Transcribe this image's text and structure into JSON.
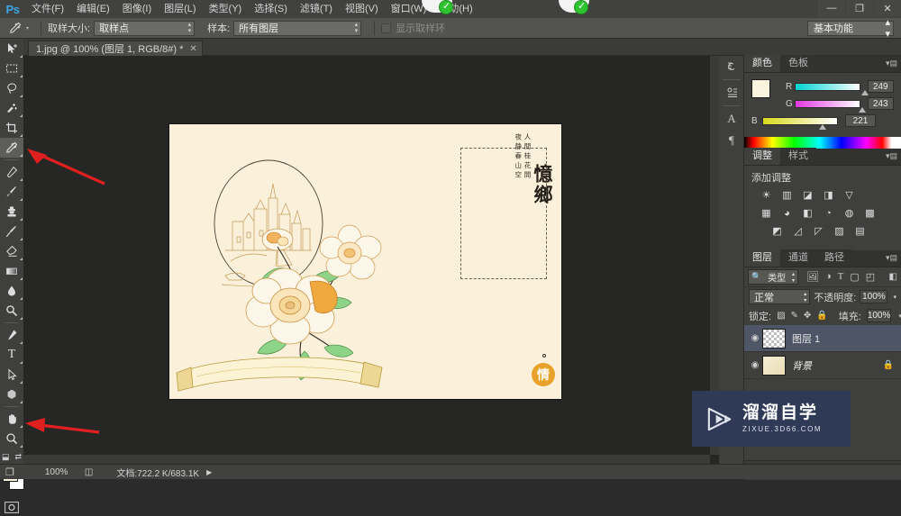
{
  "app": {
    "logo": "Ps",
    "title": "Adobe Photoshop"
  },
  "menubar": {
    "items": [
      {
        "label": "文件(F)"
      },
      {
        "label": "编辑(E)"
      },
      {
        "label": "图像(I)"
      },
      {
        "label": "图层(L)"
      },
      {
        "label": "类型(Y)"
      },
      {
        "label": "选择(S)"
      },
      {
        "label": "滤镜(T)"
      },
      {
        "label": "视图(V)"
      },
      {
        "label": "窗口(W)"
      },
      {
        "label": "帮助(H)"
      }
    ],
    "window_controls": {
      "minimize": "—",
      "restore": "❐",
      "close": "✕"
    }
  },
  "options_bar": {
    "tool_icon": "eyedropper-icon",
    "sample_size_label": "取样大小:",
    "sample_size_value": "取样点",
    "sample_label": "样本:",
    "sample_value": "所有图层",
    "show_ring_label": "显示取样环",
    "workspace_value": "基本功能"
  },
  "document_tab": {
    "title": "1.jpg @ 100% (图层 1, RGB/8#) *",
    "close": "✕"
  },
  "toolbar": {
    "tools": [
      {
        "name": "move-tool",
        "selected": false
      },
      {
        "name": "marquee-tool",
        "selected": false
      },
      {
        "name": "lasso-tool",
        "selected": false
      },
      {
        "name": "quick-selection-tool",
        "selected": false
      },
      {
        "name": "crop-tool",
        "selected": false
      },
      {
        "name": "eyedropper-tool",
        "selected": true
      },
      {
        "name": "healing-brush-tool",
        "selected": false
      },
      {
        "name": "brush-tool",
        "selected": false
      },
      {
        "name": "clone-stamp-tool",
        "selected": false
      },
      {
        "name": "history-brush-tool",
        "selected": false
      },
      {
        "name": "eraser-tool",
        "selected": false
      },
      {
        "name": "gradient-tool",
        "selected": false
      },
      {
        "name": "blur-tool",
        "selected": false
      },
      {
        "name": "dodge-tool",
        "selected": false
      },
      {
        "name": "pen-tool",
        "selected": false
      },
      {
        "name": "type-tool",
        "selected": false
      },
      {
        "name": "path-selection-tool",
        "selected": false
      },
      {
        "name": "shape-tool",
        "selected": false
      },
      {
        "name": "hand-tool",
        "selected": false
      },
      {
        "name": "zoom-tool",
        "selected": false
      }
    ],
    "foreground_color": "#faf3dd",
    "background_color": "#ffffff"
  },
  "canvas": {
    "artboard_color": "#fbf0d9",
    "poem_col_1": "人閒桂花開",
    "poem_col_2": "夜静春山空",
    "title": "憶鄉",
    "seal": "情"
  },
  "icon_dock": {
    "items": [
      {
        "name": "history-icon"
      },
      {
        "name": "actions-icon"
      },
      {
        "name": "character-icon",
        "glyph": "A"
      },
      {
        "name": "paragraph-icon",
        "glyph": "¶"
      }
    ]
  },
  "color_panel": {
    "tabs": [
      {
        "label": "颜色",
        "active": true
      },
      {
        "label": "色板",
        "active": false
      }
    ],
    "channels": [
      {
        "label": "R",
        "value": "249",
        "pos": 84
      },
      {
        "label": "G",
        "value": "243",
        "pos": 81
      },
      {
        "label": "B",
        "value": "221",
        "pos": 73
      }
    ]
  },
  "adjustments_panel": {
    "tabs": [
      {
        "label": "调整",
        "active": true
      },
      {
        "label": "样式",
        "active": false
      }
    ],
    "add_label": "添加调整",
    "rows": [
      [
        "☀",
        "▥",
        "◪",
        "◨",
        "▽"
      ],
      [
        "▦",
        "◕",
        "◧",
        "◔",
        "◍",
        "▩"
      ],
      [
        "◩",
        "◿",
        "◸",
        "▨",
        "▤"
      ]
    ]
  },
  "layers_panel": {
    "tabs": [
      {
        "label": "图层",
        "active": true
      },
      {
        "label": "通道",
        "active": false
      },
      {
        "label": "路径",
        "active": false
      }
    ],
    "kind_filter": "类型",
    "blend_mode": "正常",
    "opacity_label": "不透明度:",
    "opacity_value": "100%",
    "lock_label": "锁定:",
    "fill_label": "填充:",
    "fill_value": "100%",
    "layers": [
      {
        "name": "图层 1",
        "selected": true,
        "locked": false,
        "thumb": "checker",
        "visible": "◉"
      },
      {
        "name": "背景",
        "selected": false,
        "locked": true,
        "thumb": "bg",
        "visible": "◉"
      }
    ],
    "footer_icons": [
      "link-icon",
      "fx-icon",
      "mask-icon",
      "adjustment-icon",
      "group-icon",
      "new-layer-icon",
      "delete-icon"
    ]
  },
  "status_bar": {
    "zoom": "100%",
    "doc_label": "文档:722.2 K/683.1K",
    "arrow": "▶"
  },
  "watermark": {
    "cn": "溜溜自学",
    "en": "ZIXUE.3D66.COM",
    "bg": "#2e3a56"
  }
}
